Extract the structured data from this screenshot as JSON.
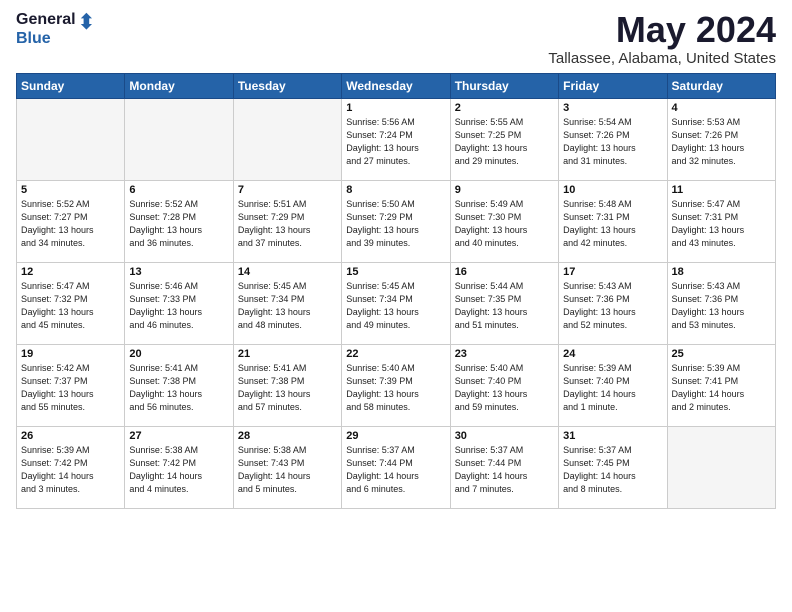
{
  "header": {
    "logo_line1": "General",
    "logo_line2": "Blue",
    "month": "May 2024",
    "location": "Tallassee, Alabama, United States"
  },
  "weekdays": [
    "Sunday",
    "Monday",
    "Tuesday",
    "Wednesday",
    "Thursday",
    "Friday",
    "Saturday"
  ],
  "weeks": [
    [
      {
        "day": "",
        "info": ""
      },
      {
        "day": "",
        "info": ""
      },
      {
        "day": "",
        "info": ""
      },
      {
        "day": "1",
        "info": "Sunrise: 5:56 AM\nSunset: 7:24 PM\nDaylight: 13 hours\nand 27 minutes."
      },
      {
        "day": "2",
        "info": "Sunrise: 5:55 AM\nSunset: 7:25 PM\nDaylight: 13 hours\nand 29 minutes."
      },
      {
        "day": "3",
        "info": "Sunrise: 5:54 AM\nSunset: 7:26 PM\nDaylight: 13 hours\nand 31 minutes."
      },
      {
        "day": "4",
        "info": "Sunrise: 5:53 AM\nSunset: 7:26 PM\nDaylight: 13 hours\nand 32 minutes."
      }
    ],
    [
      {
        "day": "5",
        "info": "Sunrise: 5:52 AM\nSunset: 7:27 PM\nDaylight: 13 hours\nand 34 minutes."
      },
      {
        "day": "6",
        "info": "Sunrise: 5:52 AM\nSunset: 7:28 PM\nDaylight: 13 hours\nand 36 minutes."
      },
      {
        "day": "7",
        "info": "Sunrise: 5:51 AM\nSunset: 7:29 PM\nDaylight: 13 hours\nand 37 minutes."
      },
      {
        "day": "8",
        "info": "Sunrise: 5:50 AM\nSunset: 7:29 PM\nDaylight: 13 hours\nand 39 minutes."
      },
      {
        "day": "9",
        "info": "Sunrise: 5:49 AM\nSunset: 7:30 PM\nDaylight: 13 hours\nand 40 minutes."
      },
      {
        "day": "10",
        "info": "Sunrise: 5:48 AM\nSunset: 7:31 PM\nDaylight: 13 hours\nand 42 minutes."
      },
      {
        "day": "11",
        "info": "Sunrise: 5:47 AM\nSunset: 7:31 PM\nDaylight: 13 hours\nand 43 minutes."
      }
    ],
    [
      {
        "day": "12",
        "info": "Sunrise: 5:47 AM\nSunset: 7:32 PM\nDaylight: 13 hours\nand 45 minutes."
      },
      {
        "day": "13",
        "info": "Sunrise: 5:46 AM\nSunset: 7:33 PM\nDaylight: 13 hours\nand 46 minutes."
      },
      {
        "day": "14",
        "info": "Sunrise: 5:45 AM\nSunset: 7:34 PM\nDaylight: 13 hours\nand 48 minutes."
      },
      {
        "day": "15",
        "info": "Sunrise: 5:45 AM\nSunset: 7:34 PM\nDaylight: 13 hours\nand 49 minutes."
      },
      {
        "day": "16",
        "info": "Sunrise: 5:44 AM\nSunset: 7:35 PM\nDaylight: 13 hours\nand 51 minutes."
      },
      {
        "day": "17",
        "info": "Sunrise: 5:43 AM\nSunset: 7:36 PM\nDaylight: 13 hours\nand 52 minutes."
      },
      {
        "day": "18",
        "info": "Sunrise: 5:43 AM\nSunset: 7:36 PM\nDaylight: 13 hours\nand 53 minutes."
      }
    ],
    [
      {
        "day": "19",
        "info": "Sunrise: 5:42 AM\nSunset: 7:37 PM\nDaylight: 13 hours\nand 55 minutes."
      },
      {
        "day": "20",
        "info": "Sunrise: 5:41 AM\nSunset: 7:38 PM\nDaylight: 13 hours\nand 56 minutes."
      },
      {
        "day": "21",
        "info": "Sunrise: 5:41 AM\nSunset: 7:38 PM\nDaylight: 13 hours\nand 57 minutes."
      },
      {
        "day": "22",
        "info": "Sunrise: 5:40 AM\nSunset: 7:39 PM\nDaylight: 13 hours\nand 58 minutes."
      },
      {
        "day": "23",
        "info": "Sunrise: 5:40 AM\nSunset: 7:40 PM\nDaylight: 13 hours\nand 59 minutes."
      },
      {
        "day": "24",
        "info": "Sunrise: 5:39 AM\nSunset: 7:40 PM\nDaylight: 14 hours\nand 1 minute."
      },
      {
        "day": "25",
        "info": "Sunrise: 5:39 AM\nSunset: 7:41 PM\nDaylight: 14 hours\nand 2 minutes."
      }
    ],
    [
      {
        "day": "26",
        "info": "Sunrise: 5:39 AM\nSunset: 7:42 PM\nDaylight: 14 hours\nand 3 minutes."
      },
      {
        "day": "27",
        "info": "Sunrise: 5:38 AM\nSunset: 7:42 PM\nDaylight: 14 hours\nand 4 minutes."
      },
      {
        "day": "28",
        "info": "Sunrise: 5:38 AM\nSunset: 7:43 PM\nDaylight: 14 hours\nand 5 minutes."
      },
      {
        "day": "29",
        "info": "Sunrise: 5:37 AM\nSunset: 7:44 PM\nDaylight: 14 hours\nand 6 minutes."
      },
      {
        "day": "30",
        "info": "Sunrise: 5:37 AM\nSunset: 7:44 PM\nDaylight: 14 hours\nand 7 minutes."
      },
      {
        "day": "31",
        "info": "Sunrise: 5:37 AM\nSunset: 7:45 PM\nDaylight: 14 hours\nand 8 minutes."
      },
      {
        "day": "",
        "info": ""
      }
    ]
  ]
}
